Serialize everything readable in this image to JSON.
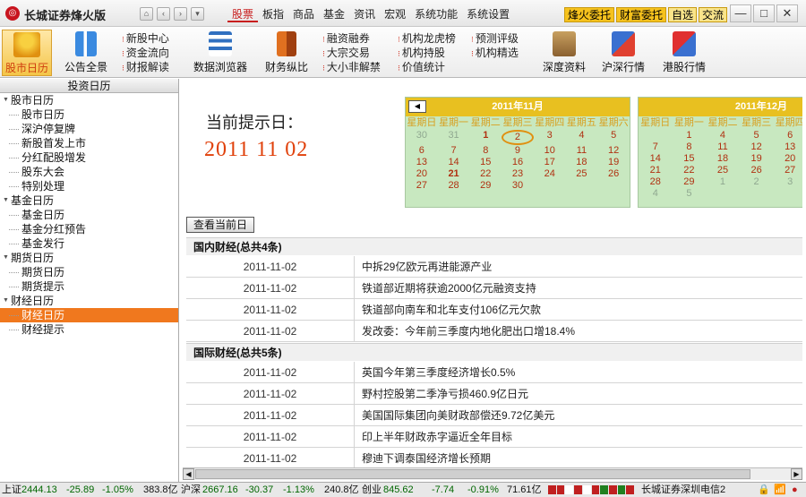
{
  "app": {
    "title": "长城证券烽火版",
    "logo_char": "◎"
  },
  "nav_buttons": [
    "⌂",
    "‹",
    "›",
    "▾"
  ],
  "menu": [
    "股票",
    "板指",
    "商品",
    "基金",
    "资讯",
    "宏观",
    "系统功能",
    "系统设置"
  ],
  "quick_buttons": [
    "烽火委托",
    "财富委托",
    "自选",
    "交流"
  ],
  "window_controls": [
    "—",
    "□",
    "✕"
  ],
  "toolbar": {
    "big": [
      "股市日历",
      "公告全景",
      "数据浏览器",
      "财务纵比",
      "深度资料",
      "沪深行情",
      "港股行情"
    ],
    "small_col1": [
      "新股中心",
      "资金流向",
      "财报解读"
    ],
    "small_col2": [
      "融资融券",
      "大宗交易",
      "大小非解禁"
    ],
    "small_col3": [
      "机构龙虎榜",
      "机构持股",
      "价值统计"
    ],
    "small_col4": [
      "预测评级",
      "机构精选"
    ]
  },
  "sidebar": {
    "header": "投资日历",
    "items": [
      {
        "label": "股市日历",
        "type": "group"
      },
      {
        "label": "股市日历",
        "type": "child"
      },
      {
        "label": "深沪停复牌",
        "type": "child"
      },
      {
        "label": "新股首发上市",
        "type": "child"
      },
      {
        "label": "分红配股增发",
        "type": "child"
      },
      {
        "label": "股东大会",
        "type": "child"
      },
      {
        "label": "特别处理",
        "type": "child"
      },
      {
        "label": "基金日历",
        "type": "group"
      },
      {
        "label": "基金日历",
        "type": "child"
      },
      {
        "label": "基金分红预告",
        "type": "child"
      },
      {
        "label": "基金发行",
        "type": "child"
      },
      {
        "label": "期货日历",
        "type": "group"
      },
      {
        "label": "期货日历",
        "type": "child"
      },
      {
        "label": "期货提示",
        "type": "child"
      },
      {
        "label": "财经日历",
        "type": "group"
      },
      {
        "label": "财经日历",
        "type": "child",
        "selected": true
      },
      {
        "label": "财经提示",
        "type": "child"
      }
    ]
  },
  "main": {
    "prompt": "当前提示日：",
    "date_display": "2011 11 02",
    "today_button": "查看当前日"
  },
  "calendar": {
    "weekdays": [
      "星期日",
      "星期一",
      "星期二",
      "星期三",
      "星期四",
      "星期五",
      "星期六"
    ],
    "prev_label": "◀",
    "months": [
      {
        "title": "2011年11月",
        "days": [
          {
            "d": "30",
            "m": true
          },
          {
            "d": "31",
            "m": true
          },
          {
            "d": "1",
            "b": true
          },
          {
            "d": "2",
            "t": true
          },
          {
            "d": "3"
          },
          {
            "d": "4"
          },
          {
            "d": "5"
          },
          {
            "d": "6"
          },
          {
            "d": "7"
          },
          {
            "d": "8"
          },
          {
            "d": "9"
          },
          {
            "d": "10"
          },
          {
            "d": "11"
          },
          {
            "d": "12"
          },
          {
            "d": "13"
          },
          {
            "d": "14"
          },
          {
            "d": "15"
          },
          {
            "d": "16"
          },
          {
            "d": "17"
          },
          {
            "d": "18"
          },
          {
            "d": "19"
          },
          {
            "d": "20"
          },
          {
            "d": "21",
            "b": true
          },
          {
            "d": "22"
          },
          {
            "d": "23"
          },
          {
            "d": "24"
          },
          {
            "d": "25"
          },
          {
            "d": "26"
          },
          {
            "d": "27"
          },
          {
            "d": "28"
          },
          {
            "d": "29"
          },
          {
            "d": "30"
          }
        ]
      },
      {
        "title": "2011年12月",
        "days": [
          {
            "d": ""
          },
          {
            "d": ""
          },
          {
            "d": ""
          },
          {
            "d": ""
          },
          {
            "d": ""
          },
          {
            "d": ""
          },
          {
            "d": "1"
          },
          {
            "d": "4"
          },
          {
            "d": "5"
          },
          {
            "d": "6"
          },
          {
            "d": "7"
          },
          {
            "d": "8"
          },
          {
            "d": "11"
          },
          {
            "d": "12"
          },
          {
            "d": "13"
          },
          {
            "d": "14"
          },
          {
            "d": "15"
          },
          {
            "d": "18"
          },
          {
            "d": "19"
          },
          {
            "d": "20"
          },
          {
            "d": "21"
          },
          {
            "d": "22"
          },
          {
            "d": "25"
          },
          {
            "d": "26"
          },
          {
            "d": "27"
          },
          {
            "d": "28"
          },
          {
            "d": "29"
          },
          {
            "d": "1",
            "m": true
          },
          {
            "d": "2",
            "m": true
          },
          {
            "d": "3",
            "m": true
          },
          {
            "d": "4",
            "m": true
          },
          {
            "d": "5",
            "m": true
          }
        ]
      }
    ]
  },
  "domestic": {
    "title": "国内财经(总共4条)",
    "rows": [
      {
        "date": "2011-11-02",
        "title": "中拆29亿欧元再进能源产业"
      },
      {
        "date": "2011-11-02",
        "title": "铁道部近期将获逾2000亿元融资支持"
      },
      {
        "date": "2011-11-02",
        "title": "铁道部向南车和北车支付106亿元欠款"
      },
      {
        "date": "2011-11-02",
        "title": "发改委：今年前三季度内地化肥出口增18.4%"
      }
    ]
  },
  "international": {
    "title": "国际财经(总共5条)",
    "rows": [
      {
        "date": "2011-11-02",
        "title": "英国今年第三季度经济增长0.5%"
      },
      {
        "date": "2011-11-02",
        "title": "野村控股第二季净亏损460.9亿日元"
      },
      {
        "date": "2011-11-02",
        "title": "美国国际集团向美财政部偿还9.72亿美元"
      },
      {
        "date": "2011-11-02",
        "title": "印上半年财政赤字逼近全年目标"
      },
      {
        "date": "2011-11-02",
        "title": "穆迪下调泰国经济增长预期"
      }
    ]
  },
  "status": {
    "sh_label": "上证",
    "sh_index": "2444.13",
    "sh_change": "-25.89",
    "sh_pct": "-1.05%",
    "sh_vol": "383.8亿",
    "sz_label": "沪深",
    "sz_index": "2667.16",
    "sz_change": "-30.37",
    "sz_pct": "-1.13%",
    "sz_vol": "240.8亿",
    "cy_label": "创业",
    "cy_index": "845.62",
    "cy_change": "-7.74",
    "cy_pct": "-0.91%",
    "cy_vol": "71.61亿",
    "server": "长城证券深圳电信2"
  },
  "colors": {
    "accent": "#c81e1e",
    "selected": "#f0781e",
    "calendar_bg": "#c8e8c0",
    "calendar_head": "#e8c020",
    "down": "#006600"
  }
}
